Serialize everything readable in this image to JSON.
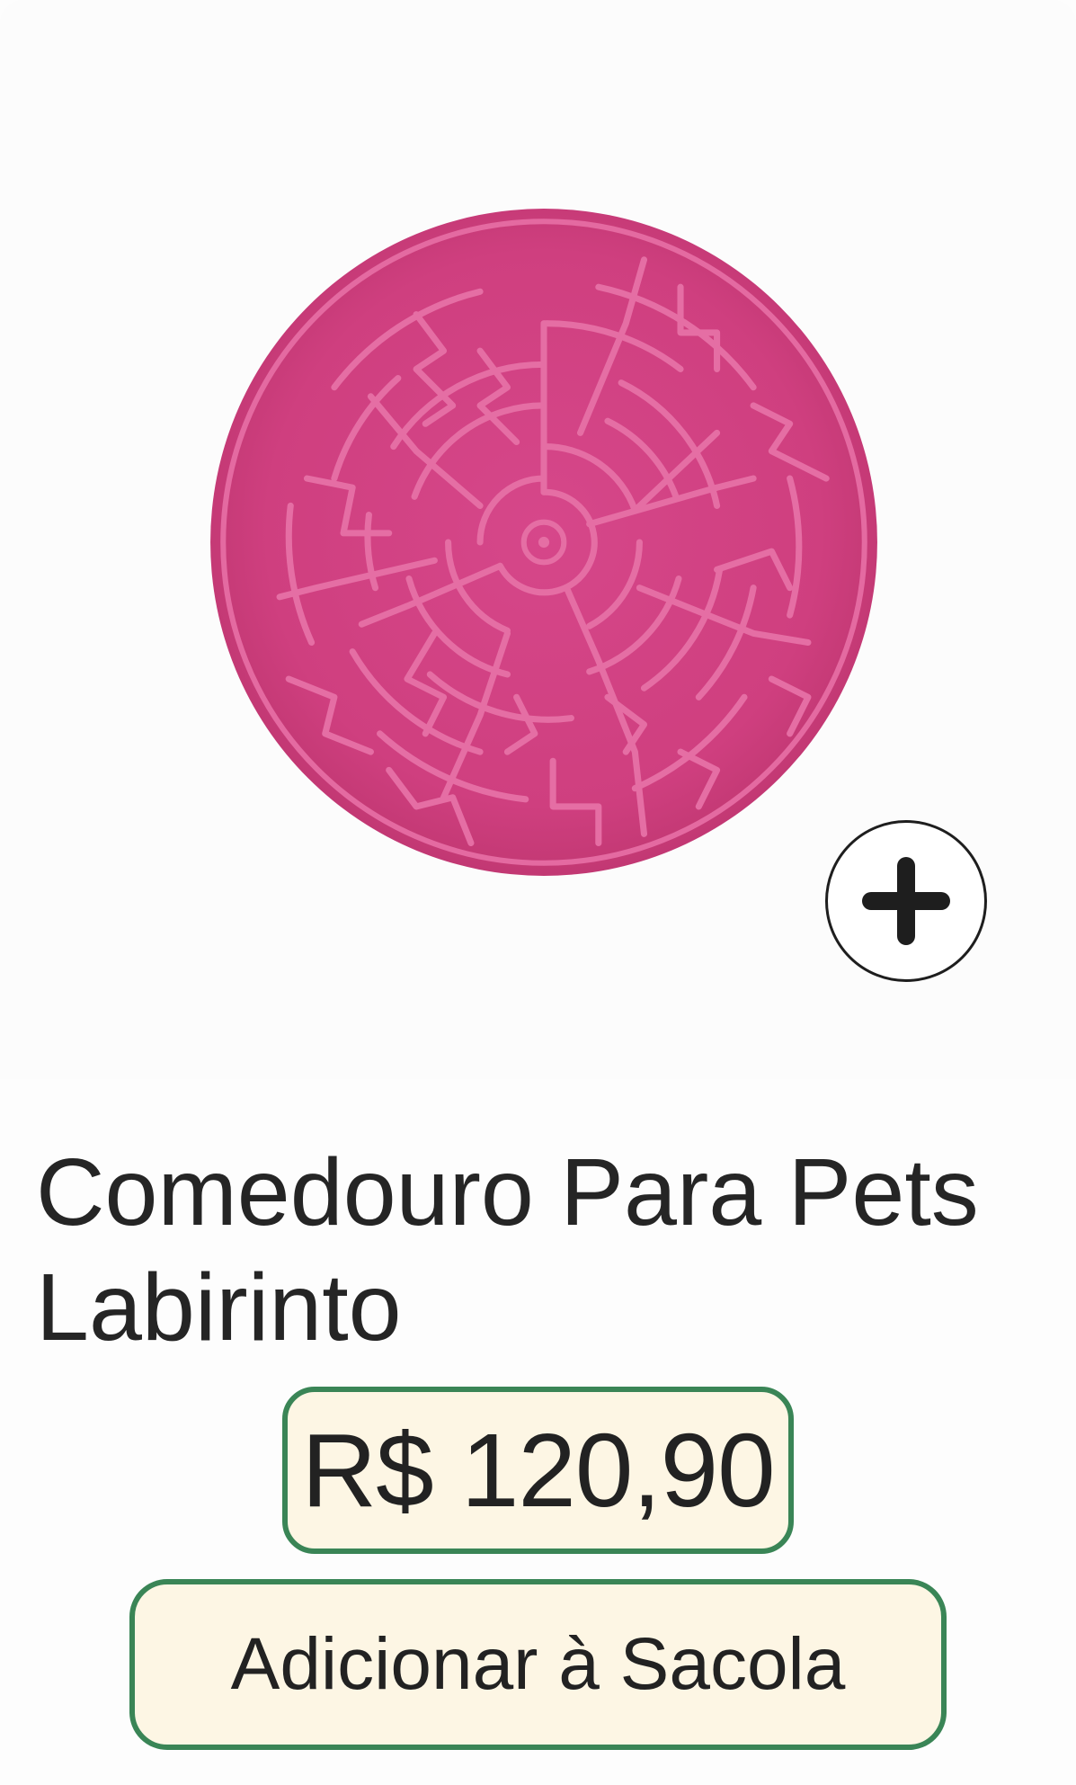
{
  "product": {
    "image_icon": "maze-lick-mat-image",
    "image_color": "#d2447e",
    "title": "Comedouro Para Pets Labirinto",
    "price": "R$ 120,90",
    "add_to_bag_label": "Adicionar à Sacola",
    "zoom_icon": "plus-circle-icon"
  },
  "colors": {
    "accent_border": "#3a8556",
    "button_fill": "#fdf6e4",
    "text": "#222222"
  }
}
